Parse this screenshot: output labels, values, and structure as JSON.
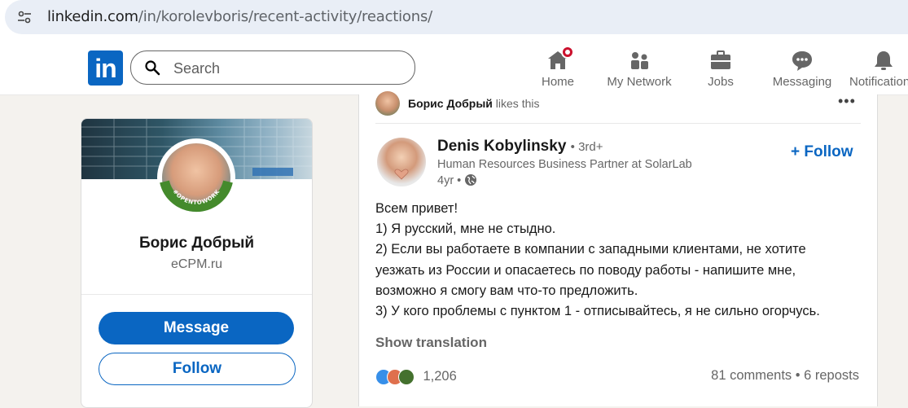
{
  "browser": {
    "url_host": "linkedin.com",
    "url_path": "/in/korolevboris/recent-activity/reactions/"
  },
  "nav": {
    "logo_text": "in",
    "search_placeholder": "Search",
    "items": [
      {
        "label": "Home",
        "icon": "home-icon"
      },
      {
        "label": "My Network",
        "icon": "network-icon"
      },
      {
        "label": "Jobs",
        "icon": "briefcase-icon"
      },
      {
        "label": "Messaging",
        "icon": "messaging-icon"
      },
      {
        "label": "Notification",
        "icon": "bell-icon"
      }
    ]
  },
  "profile": {
    "badge_text": "#OPENTOWORK",
    "name": "Борис Добрый",
    "subtitle": "eCPM.ru",
    "message_label": "Message",
    "follow_label": "Follow"
  },
  "feed": {
    "liker_name": "Борис Добрый",
    "liker_action": "likes this",
    "author": {
      "name": "Denis Kobylinsky",
      "degree": "• 3rd+",
      "title": "Human Resources Business Partner at SolarLab",
      "time": "4yr •"
    },
    "follow_label": "Follow",
    "post_lines": [
      "Всем привет!",
      "1) Я русский, мне не стыдно.",
      "2) Если вы работаете в компании с западными клиентами, не хотите",
      "уезжать из России и опасаетесь по поводу работы - напишите мне,",
      "возможно я смогу вам что-то предложить.",
      "3) У кого проблемы с пунктом 1 - отписывайтесь, я не сильно огорчусь."
    ],
    "show_translation": "Show translation",
    "reaction_count": "1,206",
    "social_counts": "81 comments • 6 reposts"
  },
  "colors": {
    "brand_blue": "#0a66c2",
    "notification_red": "#cb112d",
    "page_bg": "#f4f2ee"
  }
}
